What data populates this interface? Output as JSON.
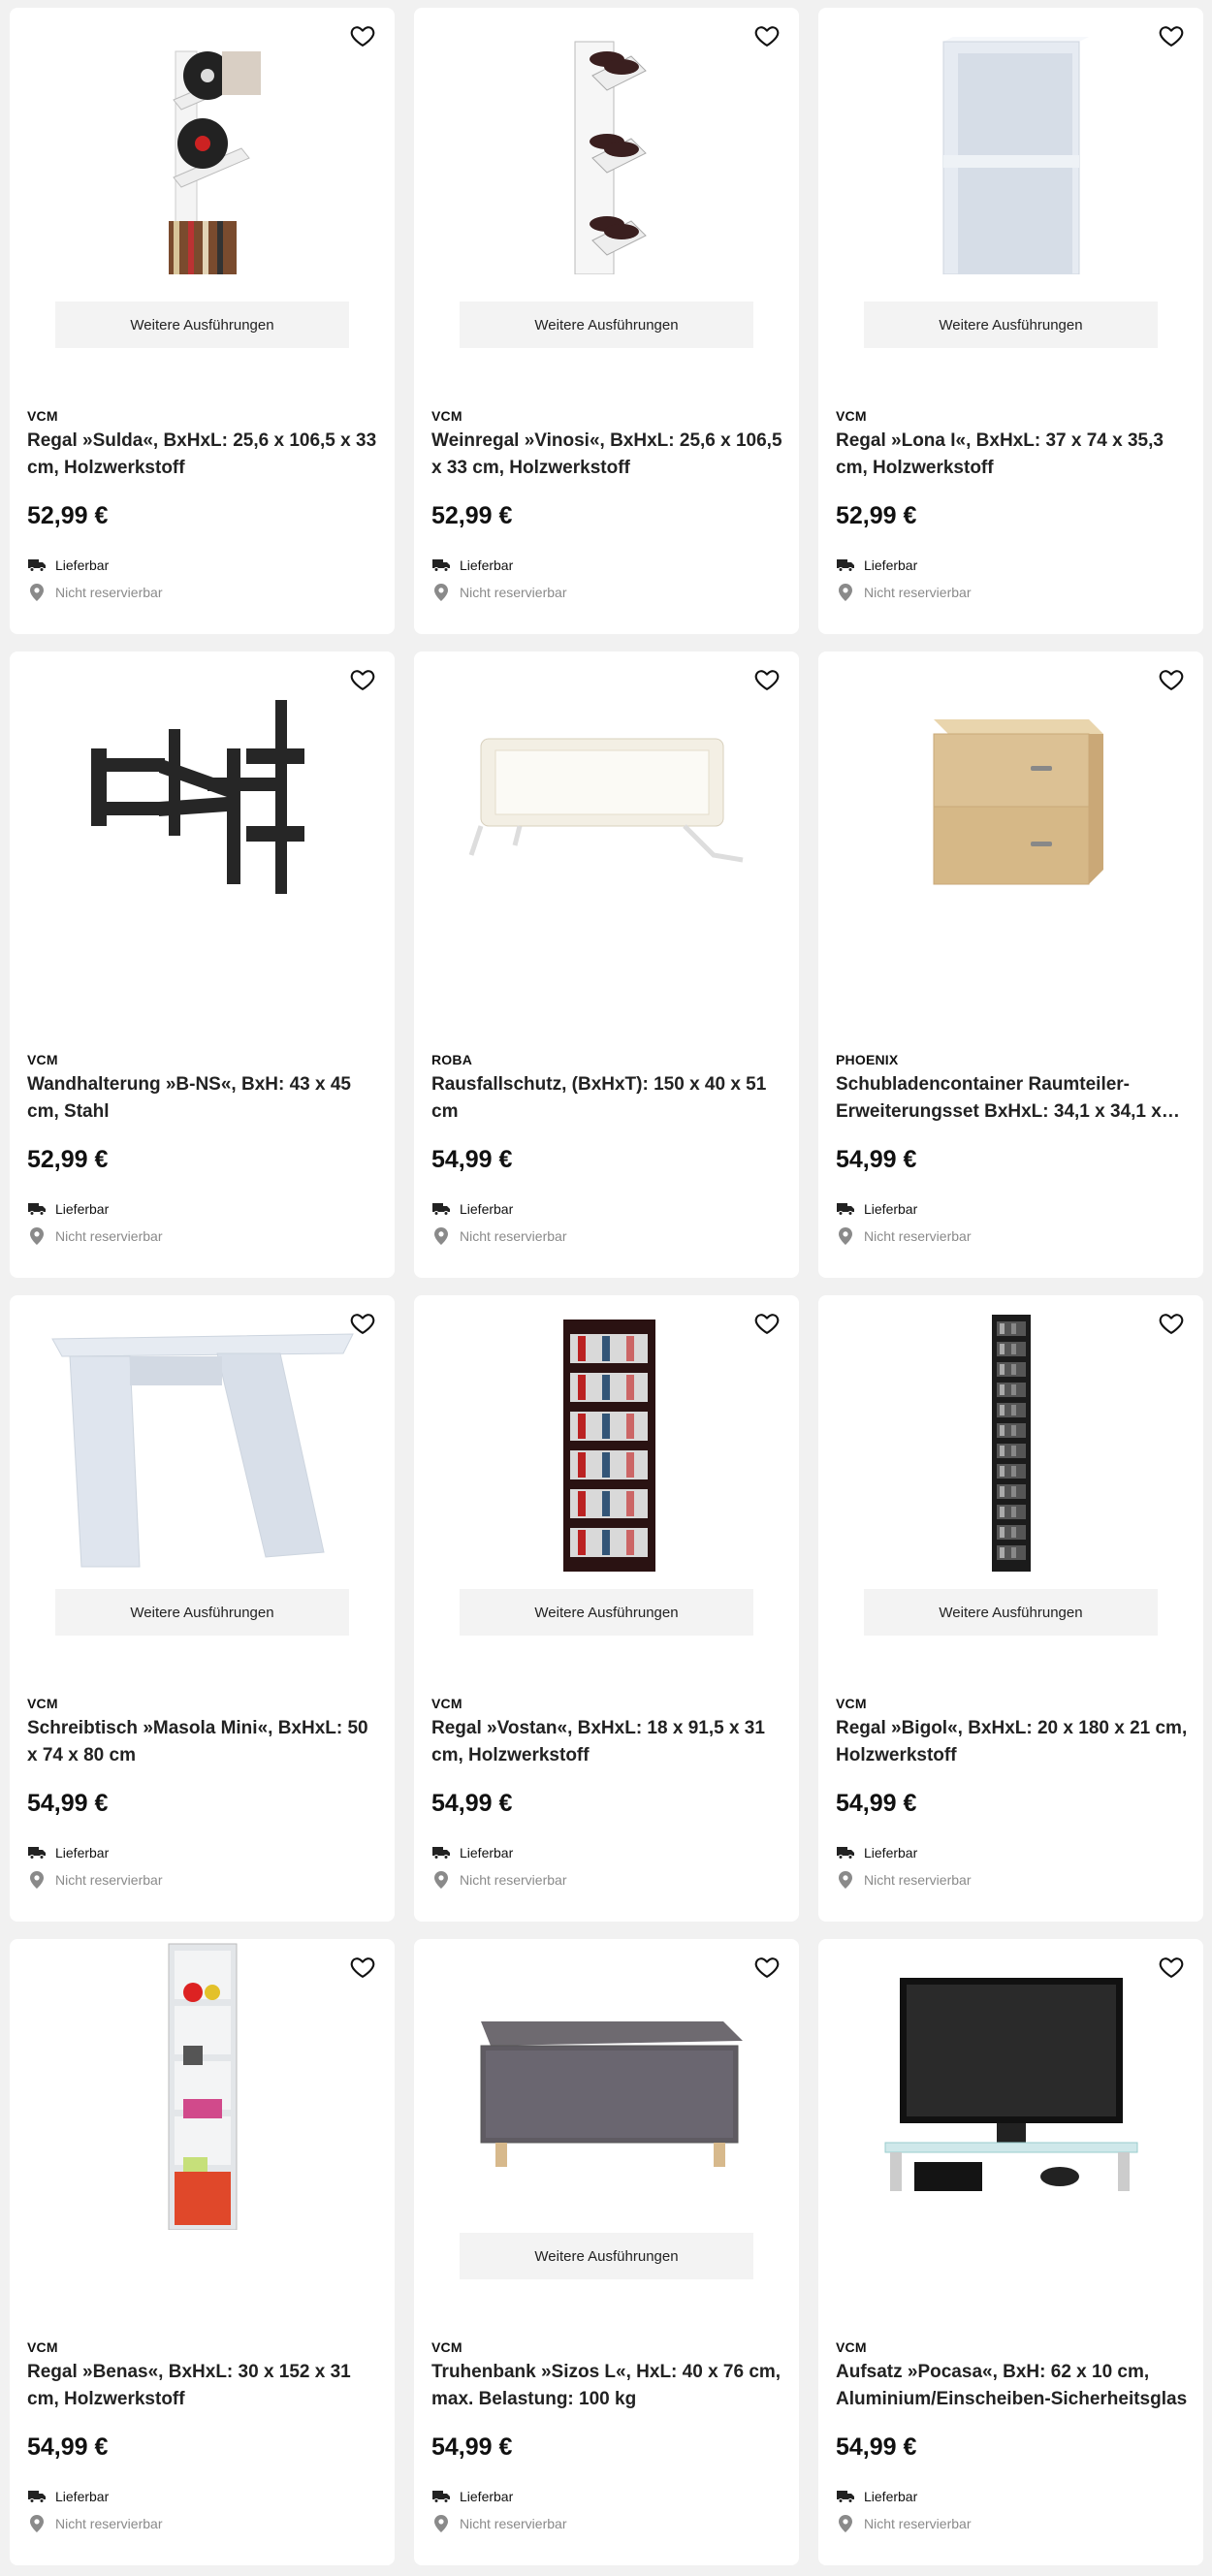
{
  "products": [
    {
      "brand": "VCM",
      "title": "Regal »Sulda«, BxHxL: 25,6 x 106,5 x 33 cm, Holzwerkstoff",
      "price": "52,99 €",
      "variants_label": "Weitere Ausführungen",
      "delivery": "Lieferbar",
      "store": "Nicht reservierbar",
      "image": "record-shelf"
    },
    {
      "brand": "VCM",
      "title": "Weinregal »Vinosi«, BxHxL: 25,6 x 106,5 x 33 cm, Holzwerkstoff",
      "price": "52,99 €",
      "variants_label": "Weitere Ausführungen",
      "delivery": "Lieferbar",
      "store": "Nicht reservierbar",
      "image": "wine-rack"
    },
    {
      "brand": "VCM",
      "title": "Regal »Lona I«, BxHxL: 37 x 74 x 35,3 cm, Holzwerkstoff",
      "price": "52,99 €",
      "variants_label": "Weitere Ausführungen",
      "delivery": "Lieferbar",
      "store": "Nicht reservierbar",
      "image": "white-shelf"
    },
    {
      "brand": "VCM",
      "title": "Wandhalterung »B-NS«, BxH: 43 x 45 cm, Stahl",
      "price": "52,99 €",
      "variants_label": "",
      "delivery": "Lieferbar",
      "store": "Nicht reservierbar",
      "image": "wall-mount"
    },
    {
      "brand": "ROBA",
      "title": "Rausfallschutz, (BxHxT): 150 x 40 x 51 cm",
      "price": "54,99 €",
      "variants_label": "",
      "delivery": "Lieferbar",
      "store": "Nicht reservierbar",
      "image": "bed-rail"
    },
    {
      "brand": "PHOENIX",
      "title": "Schubladencontainer Raumteiler-Erweiterungsset BxHxL: 34,1 x 34,1 x…",
      "price": "54,99 €",
      "variants_label": "",
      "delivery": "Lieferbar",
      "store": "Nicht reservierbar",
      "image": "drawer-box"
    },
    {
      "brand": "VCM",
      "title": "Schreibtisch »Masola Mini«, BxHxL: 50 x 74 x 80 cm",
      "price": "54,99 €",
      "variants_label": "Weitere Ausführungen",
      "delivery": "Lieferbar",
      "store": "Nicht reservierbar",
      "image": "desk"
    },
    {
      "brand": "VCM",
      "title": "Regal »Vostan«, BxHxL: 18 x 91,5 x 31 cm, Holzwerkstoff",
      "price": "54,99 €",
      "variants_label": "Weitere Ausführungen",
      "delivery": "Lieferbar",
      "store": "Nicht reservierbar",
      "image": "dvd-shelf"
    },
    {
      "brand": "VCM",
      "title": "Regal »Bigol«, BxHxL: 20 x 180 x 21 cm, Holzwerkstoff",
      "price": "54,99 €",
      "variants_label": "Weitere Ausführungen",
      "delivery": "Lieferbar",
      "store": "Nicht reservierbar",
      "image": "tall-cd-shelf"
    },
    {
      "brand": "VCM",
      "title": "Regal »Benas«, BxHxL: 30 x 152 x 31 cm, Holzwerkstoff",
      "price": "54,99 €",
      "variants_label": "",
      "delivery": "Lieferbar",
      "store": "Nicht reservierbar",
      "image": "cube-shelf"
    },
    {
      "brand": "VCM",
      "title": "Truhenbank »Sizos L«, HxL: 40 x 76 cm, max. Belastung: 100 kg",
      "price": "54,99 €",
      "variants_label": "Weitere Ausführungen",
      "delivery": "Lieferbar",
      "store": "Nicht reservierbar",
      "image": "storage-bench"
    },
    {
      "brand": "VCM",
      "title": "Aufsatz »Pocasa«, BxH: 62 x 10 cm, Aluminium/Einscheiben-Sicherheitsglas",
      "price": "54,99 €",
      "variants_label": "",
      "delivery": "Lieferbar",
      "store": "Nicht reservierbar",
      "image": "tv-stand"
    }
  ],
  "icons": {
    "favorite": "heart-outline-icon",
    "delivery": "truck-icon",
    "store": "location-pin-icon"
  },
  "colors": {
    "background": "#f1f1f1",
    "card": "#ffffff",
    "variants_bg": "#f3f3f3",
    "muted": "#8a8a8a"
  }
}
